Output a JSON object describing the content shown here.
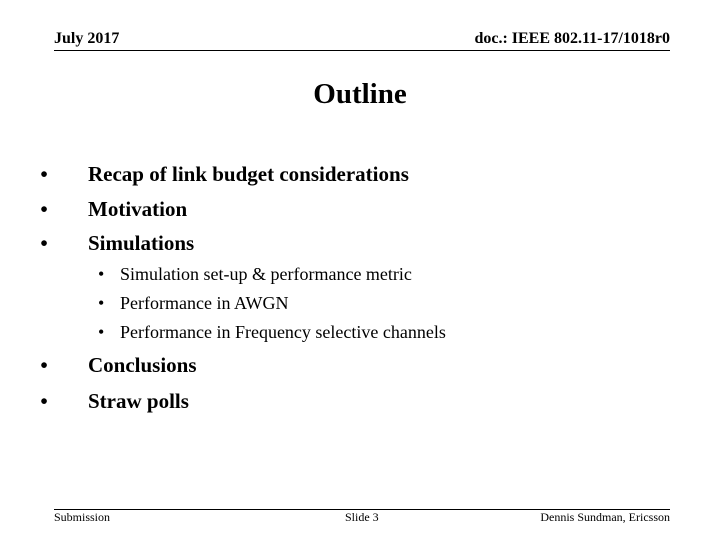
{
  "header": {
    "date": "July 2017",
    "doc_id": "doc.: IEEE 802.11-17/1018r0"
  },
  "slide": {
    "title": "Outline",
    "bullet_glyph": "•",
    "items": [
      {
        "level": 1,
        "text": "Recap of link budget considerations"
      },
      {
        "level": 1,
        "text": "Motivation"
      },
      {
        "level": 1,
        "text": "Simulations"
      },
      {
        "level": 2,
        "text": "Simulation set-up & performance metric"
      },
      {
        "level": 2,
        "text": "Performance in AWGN"
      },
      {
        "level": 2,
        "text": "Performance in Frequency selective channels"
      },
      {
        "level": 1,
        "text": "Conclusions"
      },
      {
        "level": 1,
        "text": "Straw polls"
      }
    ]
  },
  "footer": {
    "left": "Submission",
    "center": "Slide 3",
    "right": "Dennis Sundman, Ericsson"
  }
}
